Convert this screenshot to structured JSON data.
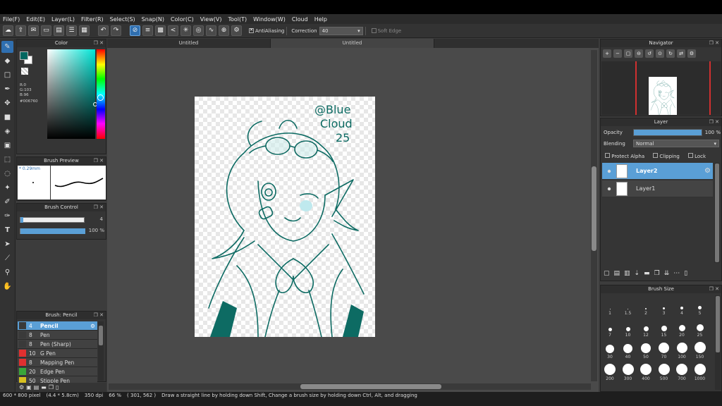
{
  "menu": [
    "File(F)",
    "Edit(E)",
    "Layer(L)",
    "Filter(R)",
    "Select(S)",
    "Snap(N)",
    "Color(C)",
    "View(V)",
    "Tool(T)",
    "Window(W)",
    "Cloud",
    "Help"
  ],
  "toolbar": {
    "antialiasing_label": "AntiAliasing",
    "correction_label": "Correction",
    "correction_value": "40",
    "soft_edge_label": "Soft Edge"
  },
  "color_panel": {
    "title": "Color",
    "rgb_r": "R:0",
    "rgb_g": "G:103",
    "rgb_b": "B:96",
    "hex": "#006760",
    "fg_color": "#006760"
  },
  "brush_preview": {
    "title": "Brush Preview",
    "size": "* 0.29mm"
  },
  "brush_control": {
    "title": "Brush Control",
    "size_value": "4",
    "opacity_value": "100 %",
    "size_fraction": 0.04,
    "opacity_fraction": 1.0
  },
  "brush_list": {
    "title": "Brush: Pencil",
    "items": [
      {
        "size": "4",
        "name": "Pencil",
        "color": "#3a3a3a",
        "selected": true
      },
      {
        "size": "8",
        "name": "Pen",
        "color": "#3a3a3a"
      },
      {
        "size": "8",
        "name": "Pen (Sharp)",
        "color": "#3a3a3a"
      },
      {
        "size": "10",
        "name": "G Pen",
        "color": "#e03030"
      },
      {
        "size": "8",
        "name": "Mapping Pen",
        "color": "#e03030"
      },
      {
        "size": "20",
        "name": "Edge Pen",
        "color": "#3aa63a"
      },
      {
        "size": "50",
        "name": "Stipple Pen",
        "color": "#d8c020"
      }
    ]
  },
  "documents": {
    "tabs": [
      "Untitled",
      "Untitled"
    ]
  },
  "artwork": {
    "signature_lines": [
      "@Blue",
      "Cloud",
      "25"
    ],
    "line_color": "#0d6b63"
  },
  "navigator": {
    "title": "Navigator"
  },
  "layer_panel": {
    "title": "Layer",
    "opacity_label": "Opacity",
    "opacity_value": "100 %",
    "opacity_fraction": 1.0,
    "blending_label": "Blending",
    "blending_value": "Normal",
    "protect_alpha": "Protect Alpha",
    "clipping": "Clipping",
    "lock": "Lock",
    "layers": [
      {
        "name": "Layer2",
        "selected": true
      },
      {
        "name": "Layer1",
        "selected": false
      }
    ]
  },
  "brush_size": {
    "title": "Brush Size",
    "sizes": [
      "1",
      "1.5",
      "2",
      "3",
      "4",
      "5",
      "7",
      "10",
      "12",
      "15",
      "20",
      "25",
      "30",
      "40",
      "50",
      "70",
      "100",
      "150",
      "200",
      "300",
      "400",
      "500",
      "700",
      "1000"
    ]
  },
  "status": {
    "size": "600 * 800 pixel",
    "physical": "(4.4 * 5.8cm)",
    "dpi": "350 dpi",
    "zoom": "66 %",
    "coords": "( 301, 562 )",
    "hint": "Draw a straight line by holding down Shift, Change a brush size by holding down Ctrl, Alt, and dragging"
  }
}
